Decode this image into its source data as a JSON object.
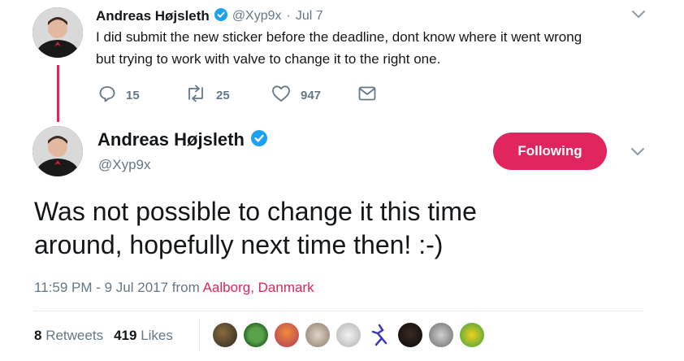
{
  "parent_tweet": {
    "author_name": "Andreas Højsleth",
    "handle": "@Xyp9x",
    "separator": "·",
    "date": "Jul 7",
    "text_line1": "I did submit the new sticker before the deadline, dont know where it went wrong",
    "text_line2": "but trying to work with valve to change it to the right one.",
    "replies": "15",
    "retweets": "25",
    "likes": "947"
  },
  "main_tweet": {
    "author_name": "Andreas Højsleth",
    "handle": "@Xyp9x",
    "follow_label": "Following",
    "text_line1": "Was not possible to change it this time",
    "text_line2": "around, hopefully next time then! :-)",
    "timestamp": "11:59 PM - 9 Jul 2017 from",
    "location": "Aalborg, Danmark",
    "retweets_count": "8",
    "retweets_label": "Retweets",
    "likes_count": "419",
    "likes_label": "Likes"
  },
  "colors": {
    "accent": "#e0245e",
    "verified": "#1da1f2",
    "muted": "#657786"
  },
  "icons": [
    "verified-badge-icon",
    "chevron-down-icon",
    "reply-icon",
    "retweet-icon",
    "heart-icon",
    "direct-message-icon"
  ]
}
